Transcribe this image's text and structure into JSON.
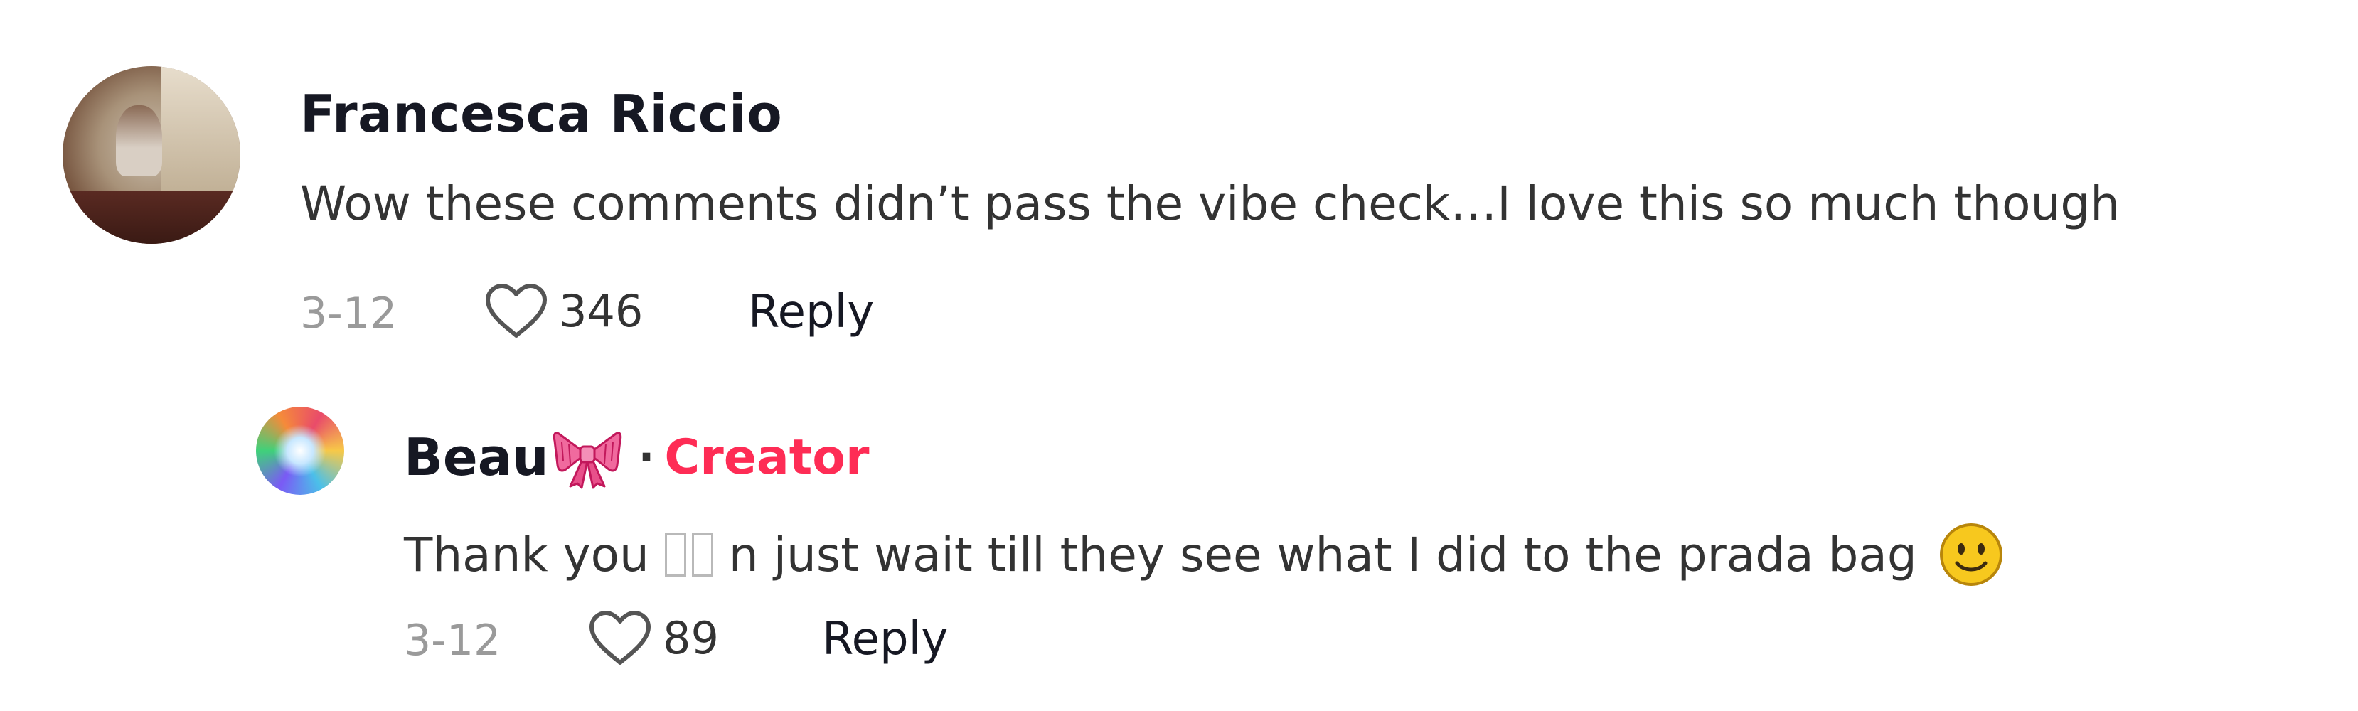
{
  "comments": [
    {
      "username": "Francesca Riccio",
      "text": "Wow these comments didn’t pass the vibe check…I love this so much though",
      "date": "3-12",
      "likes": "346",
      "reply_label": "Reply",
      "avatar_icon": "profile-photo"
    }
  ],
  "reply": {
    "username": "Beau",
    "username_emoji": "ribbon-bow-emoji",
    "separator": "·",
    "creator_badge": "Creator",
    "text_before": "Thank you",
    "text_after": "n just wait till they see what I did to the prada bag",
    "trailing_emoji": "slightly-smiling-face-emoji",
    "date": "3-12",
    "likes": "89",
    "reply_label": "Reply",
    "avatar_icon": "colorful-profile-photo"
  },
  "colors": {
    "username": "#161823",
    "body_text": "#333333",
    "meta_text": "#9a9a9a",
    "creator_accent": "#fe2c55",
    "bow_pink": "#f06a9e",
    "smile_yellow": "#f7c81e"
  }
}
